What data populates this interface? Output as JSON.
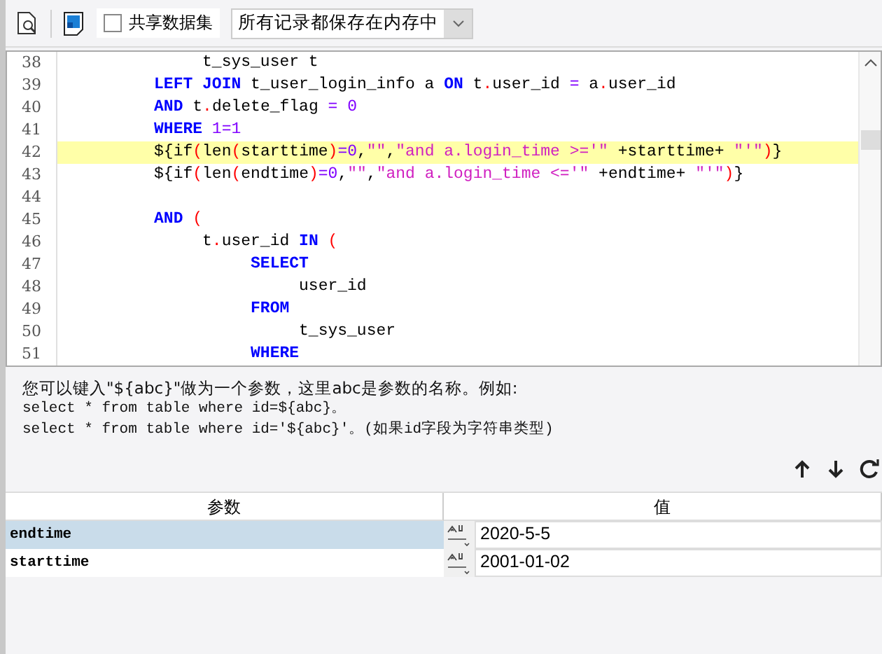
{
  "toolbar": {
    "share_dataset": {
      "label": "共享数据集",
      "checked": false
    },
    "storage_select": {
      "value": "所有记录都保存在内存中"
    }
  },
  "editor": {
    "lines": [
      {
        "number": "38",
        "highlighted": false,
        "tokens": [
          {
            "kind": "plain",
            "text": "               t_sys_user t"
          }
        ]
      },
      {
        "number": "39",
        "highlighted": false,
        "tokens": [
          {
            "kind": "keyword",
            "text": "          LEFT JOIN"
          },
          {
            "kind": "plain",
            "text": " t_user_login_info a "
          },
          {
            "kind": "keyword",
            "text": "ON"
          },
          {
            "kind": "plain",
            "text": " t"
          },
          {
            "kind": "op",
            "text": "."
          },
          {
            "kind": "plain",
            "text": "user_id "
          },
          {
            "kind": "num",
            "text": "="
          },
          {
            "kind": "plain",
            "text": " a"
          },
          {
            "kind": "op",
            "text": "."
          },
          {
            "kind": "plain",
            "text": "user_id"
          }
        ]
      },
      {
        "number": "40",
        "highlighted": false,
        "tokens": [
          {
            "kind": "keyword",
            "text": "          AND"
          },
          {
            "kind": "plain",
            "text": " t"
          },
          {
            "kind": "op",
            "text": "."
          },
          {
            "kind": "plain",
            "text": "delete_flag "
          },
          {
            "kind": "num",
            "text": "= 0"
          }
        ]
      },
      {
        "number": "41",
        "highlighted": false,
        "tokens": [
          {
            "kind": "keyword",
            "text": "          WHERE"
          },
          {
            "kind": "num",
            "text": " 1=1"
          }
        ]
      },
      {
        "number": "42",
        "highlighted": true,
        "tokens": [
          {
            "kind": "plain",
            "text": "          ${if"
          },
          {
            "kind": "op",
            "text": "("
          },
          {
            "kind": "plain",
            "text": "len"
          },
          {
            "kind": "op",
            "text": "("
          },
          {
            "kind": "plain",
            "text": "starttime"
          },
          {
            "kind": "op",
            "text": ")"
          },
          {
            "kind": "num",
            "text": "=0"
          },
          {
            "kind": "plain",
            "text": ","
          },
          {
            "kind": "str",
            "text": "\"\""
          },
          {
            "kind": "plain",
            "text": ","
          },
          {
            "kind": "str",
            "text": "\"and a.login_time >='\""
          },
          {
            "kind": "plain",
            "text": " +starttime+ "
          },
          {
            "kind": "str",
            "text": "\"'\""
          },
          {
            "kind": "op",
            "text": ")"
          },
          {
            "kind": "plain",
            "text": "}"
          }
        ]
      },
      {
        "number": "43",
        "highlighted": false,
        "tokens": [
          {
            "kind": "plain",
            "text": "          ${if"
          },
          {
            "kind": "op",
            "text": "("
          },
          {
            "kind": "plain",
            "text": "len"
          },
          {
            "kind": "op",
            "text": "("
          },
          {
            "kind": "plain",
            "text": "endtime"
          },
          {
            "kind": "op",
            "text": ")"
          },
          {
            "kind": "num",
            "text": "=0"
          },
          {
            "kind": "plain",
            "text": ","
          },
          {
            "kind": "str",
            "text": "\"\""
          },
          {
            "kind": "plain",
            "text": ","
          },
          {
            "kind": "str",
            "text": "\"and a.login_time <='\""
          },
          {
            "kind": "plain",
            "text": " +endtime+ "
          },
          {
            "kind": "str",
            "text": "\"'\""
          },
          {
            "kind": "op",
            "text": ")"
          },
          {
            "kind": "plain",
            "text": "}"
          }
        ]
      },
      {
        "number": "44",
        "highlighted": false
      },
      {
        "number": "45",
        "highlighted": false,
        "tokens": [
          {
            "kind": "keyword",
            "text": "          AND"
          },
          {
            "kind": "op",
            "text": " ("
          }
        ]
      },
      {
        "number": "46",
        "highlighted": false,
        "tokens": [
          {
            "kind": "plain",
            "text": "               t"
          },
          {
            "kind": "op",
            "text": "."
          },
          {
            "kind": "plain",
            "text": "user_id "
          },
          {
            "kind": "keyword",
            "text": "IN"
          },
          {
            "kind": "op",
            "text": " ("
          }
        ]
      },
      {
        "number": "47",
        "highlighted": false,
        "tokens": [
          {
            "kind": "keyword",
            "text": "                    SELECT"
          }
        ]
      },
      {
        "number": "48",
        "highlighted": false,
        "tokens": [
          {
            "kind": "plain",
            "text": "                         user_id"
          }
        ]
      },
      {
        "number": "49",
        "highlighted": false,
        "tokens": [
          {
            "kind": "keyword",
            "text": "                    FROM"
          }
        ]
      },
      {
        "number": "50",
        "highlighted": false,
        "tokens": [
          {
            "kind": "plain",
            "text": "                         t_sys_user"
          }
        ]
      },
      {
        "number": "51",
        "highlighted": false,
        "tokens": [
          {
            "kind": "keyword",
            "text": "                    WHERE"
          }
        ]
      }
    ]
  },
  "hint": {
    "lines": [
      {
        "kind": "text",
        "text": "您可以键入\"${abc}\"做为一个参数，这里abc是参数的名称。例如:"
      },
      {
        "kind": "code",
        "text": "select * from table where id=${abc}。"
      },
      {
        "kind": "code",
        "text": "select * from table where id='${abc}'。(如果id字段为字符串类型)"
      }
    ]
  },
  "parameters": {
    "columns": [
      "参数",
      "值"
    ],
    "rows": [
      {
        "name": "endtime",
        "value": "2020-5-5",
        "selected": true
      },
      {
        "name": "starttime",
        "value": "2001-01-02",
        "selected": false
      }
    ]
  }
}
